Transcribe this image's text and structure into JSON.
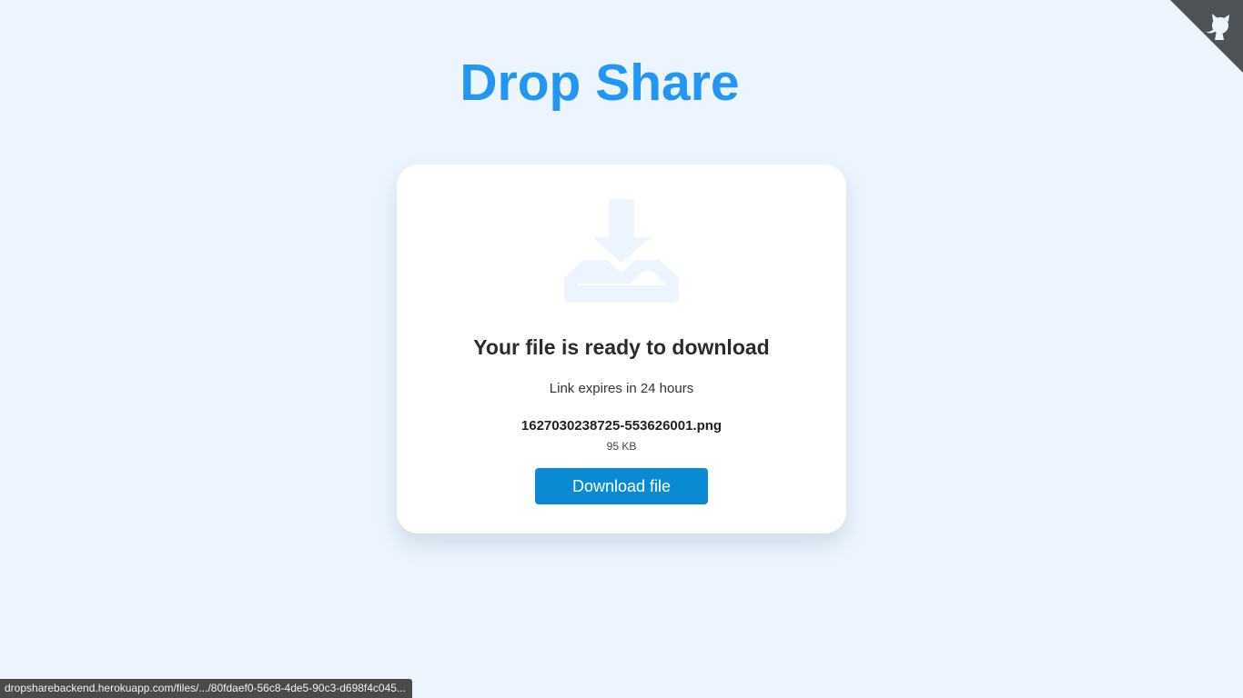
{
  "app": {
    "title": "Drop Share"
  },
  "colors": {
    "background": "#ecf5fe",
    "title": "#2196f3",
    "button": "#0a8ad3",
    "icon": "#ecf5fe",
    "corner": "#4d5357"
  },
  "card": {
    "icon": "download-icon",
    "heading": "Your file is ready to download",
    "expiry": "Link expires in 24 hours",
    "file_name": "1627030238725-553626001.png",
    "file_size": "95 KB",
    "download_label": "Download file"
  },
  "corner_link": {
    "icon": "github-octocat-icon"
  },
  "status_bar": {
    "url": "dropsharebackend.herokuapp.com/files/.../80fdaef0-56c8-4de5-90c3-d698f4c045..."
  }
}
